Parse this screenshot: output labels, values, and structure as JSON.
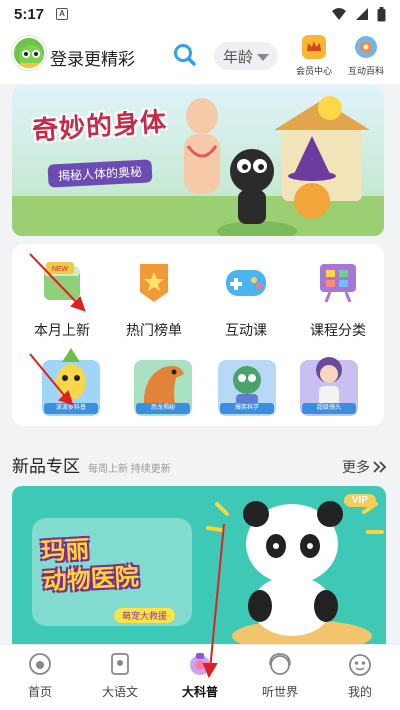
{
  "status_bar": {
    "time": "5:17",
    "notification_letter": "A"
  },
  "header": {
    "login_text": "登录更精彩",
    "age_label": "年龄",
    "vip_center_label": "会员中心",
    "interactive_wiki_label": "互动百科"
  },
  "banner": {
    "title": "奇妙的身体",
    "subtitle": "揭秘人体的奥秘"
  },
  "categories": [
    {
      "label": "本月上新",
      "icon": "new-calendar-icon"
    },
    {
      "label": "热门榜单",
      "icon": "star-badge-icon"
    },
    {
      "label": "互动课",
      "icon": "gamepad-icon"
    },
    {
      "label": "课程分类",
      "icon": "easel-board-icon"
    }
  ],
  "courses": [
    {
      "tag": "波波萝科普"
    },
    {
      "tag": "恐龙揭秘"
    },
    {
      "tag": "爆笑科学"
    },
    {
      "tag": "超级镜头"
    }
  ],
  "new_section": {
    "title": "新品专区",
    "subtitle": "每周上新 持续更新",
    "more_label": "更多",
    "promo_title_line1": "玛丽",
    "promo_title_line2": "动物医院",
    "promo_badge": "萌宠大救援",
    "vip_badge": "VIP"
  },
  "bottom_nav": [
    {
      "label": "首页",
      "icon": "home-mascot-icon"
    },
    {
      "label": "大语文",
      "icon": "book-mascot-icon"
    },
    {
      "label": "大科普",
      "icon": "science-mascot-icon",
      "active": true
    },
    {
      "label": "听世界",
      "icon": "headphone-mascot-icon"
    },
    {
      "label": "我的",
      "icon": "profile-mascot-icon"
    }
  ],
  "colors": {
    "accent_teal": "#3ec9b6",
    "search_blue": "#2ea3e6",
    "annotation_red": "#e02020"
  }
}
